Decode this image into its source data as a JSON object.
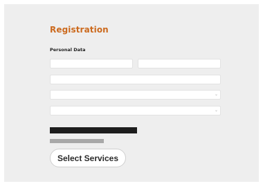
{
  "form": {
    "title": "Registration",
    "section_label": "Personal Data",
    "select_chevron_icon": "chevron-down-icon",
    "submit_label": "Select Services",
    "colors": {
      "background": "#eeeeee",
      "title_accent": "#cc6a1e",
      "dark_bar": "#1d1d1d",
      "grey_bar": "#a8a8a8"
    }
  }
}
